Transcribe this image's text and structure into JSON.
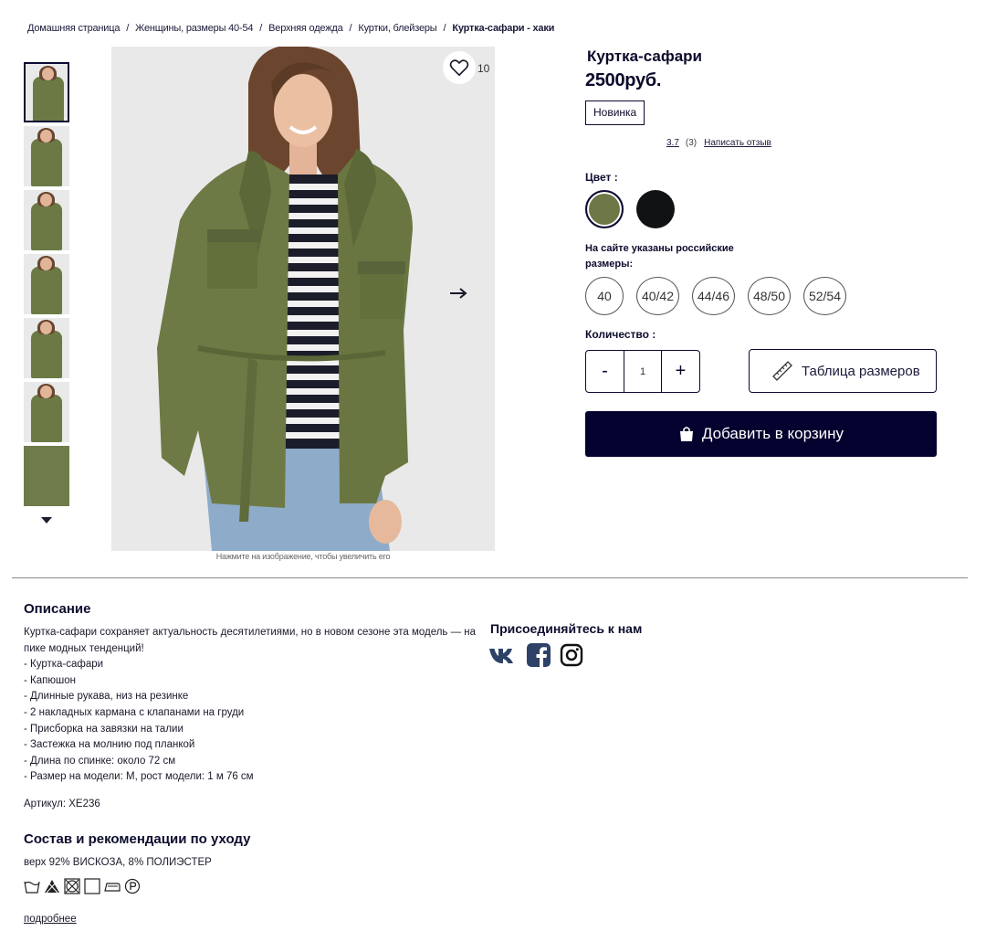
{
  "breadcrumb": {
    "home": "Домашняя страница",
    "women": "Женщины, размеры 40-54",
    "outerwear": "Верхняя одежда",
    "jackets": "Куртки, блейзеры",
    "current": "Куртка-сафари - хаки",
    "separator": "/"
  },
  "gallery": {
    "favorite_count": "10",
    "zoom_hint": "Нажмите на изображение, чтобы увеличить его",
    "thumbnail_count": 7,
    "active_index": 0
  },
  "product": {
    "title": "Куртка-сафари",
    "price": "2500руб.",
    "badge": "Новинка",
    "rating_score": "3.7",
    "rating_count": "(3)",
    "write_review": "Написать отзыв",
    "color_label": "Цвет :",
    "colors": [
      {
        "name": "khaki",
        "hex": "#6e7746",
        "selected": true
      },
      {
        "name": "black",
        "hex": "#101214",
        "selected": false
      }
    ],
    "size_note": "На сайте указаны российские размеры:",
    "sizes": [
      "40",
      "40/42",
      "44/46",
      "48/50",
      "52/54"
    ],
    "quantity_label": "Количество :",
    "quantity_minus": "-",
    "quantity_value": "1",
    "quantity_plus": "+",
    "size_table": "Таблица размеров",
    "add_to_cart": "Добавить в корзину"
  },
  "description": {
    "title": "Описание",
    "intro": "Куртка-сафари сохраняет актуальность десятилетиями, но в новом сезоне эта модель — на пике модных тенденций!",
    "lines": [
      "- Куртка-сафари",
      "- Капюшон",
      "- Длинные рукава, низ на резинке",
      "- 2 накладных кармана с клапанами на груди",
      "- Присборка на завязки на талии",
      "- Застежка на молнию под планкой",
      "- Длина по спинке: около 72 см",
      "- Размер на модели: M, рост модели: 1 м 76 см"
    ],
    "article": "Артикул: XE236"
  },
  "care": {
    "title": "Состав и рекомендации по уходу",
    "composition": "верх 92% ВИСКОЗА, 8% ПОЛИЭСТЕР",
    "icons": [
      "wash-30-icon",
      "no-bleach-icon",
      "no-tumble-dry-icon",
      "line-dry-icon",
      "iron-low-icon",
      "dry-clean-p-icon"
    ],
    "more": "подробнее"
  },
  "social": {
    "title": "Присоединяйтесь к нам",
    "networks": [
      "vk-icon",
      "facebook-icon",
      "instagram-icon"
    ]
  },
  "colors": {
    "navy": "#04022e",
    "khaki": "#6e7746",
    "text": "#0c0c2e"
  }
}
